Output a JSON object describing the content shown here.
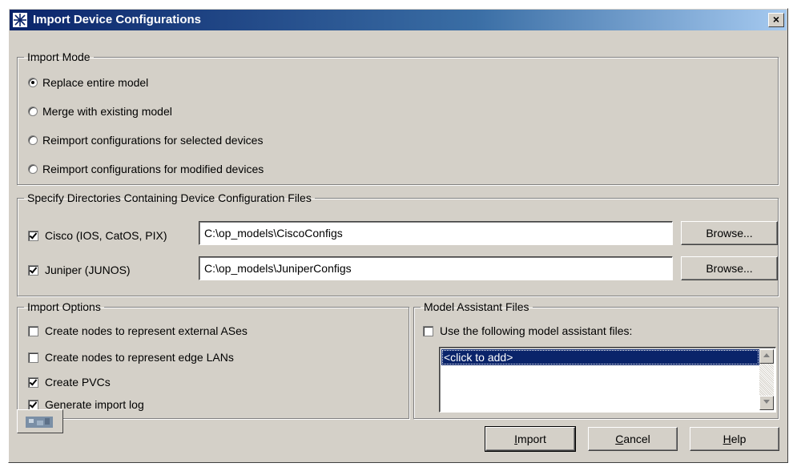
{
  "window": {
    "title": "Import Device Configurations",
    "close_label": "×"
  },
  "import_mode": {
    "legend": "Import Mode",
    "options": [
      {
        "label": "Replace entire model",
        "checked": true
      },
      {
        "label": "Merge with existing model",
        "checked": false
      },
      {
        "label": "Reimport configurations for selected devices",
        "checked": false
      },
      {
        "label": "Reimport configurations for modified devices",
        "checked": false
      }
    ]
  },
  "directories": {
    "legend": "Specify Directories Containing Device Configuration Files",
    "cisco": {
      "label": "Cisco (IOS, CatOS, PIX)",
      "checked": true,
      "path": "C:\\op_models\\CiscoConfigs",
      "browse_label": "Browse..."
    },
    "juniper": {
      "label": "Juniper (JUNOS)",
      "checked": true,
      "path": "C:\\op_models\\JuniperConfigs",
      "browse_label": "Browse..."
    }
  },
  "import_options": {
    "legend": "Import Options",
    "options": [
      {
        "label": "Create nodes to represent external ASes",
        "checked": false
      },
      {
        "label": "Create nodes to represent edge LANs",
        "checked": false
      },
      {
        "label": "Create PVCs",
        "checked": true
      },
      {
        "label": "Generate import log",
        "checked": true
      }
    ]
  },
  "model_assistant": {
    "legend": "Model Assistant Files",
    "use_label": "Use the following model assistant files:",
    "use_checked": false,
    "list_item": "<click to add>"
  },
  "buttons": {
    "import_underline": "I",
    "import_rest": "mport",
    "cancel_underline": "C",
    "cancel_rest": "ancel",
    "help_underline": "H",
    "help_rest": "elp"
  },
  "icons": {
    "app": "starburst-icon",
    "helper": "wizard-icon"
  }
}
